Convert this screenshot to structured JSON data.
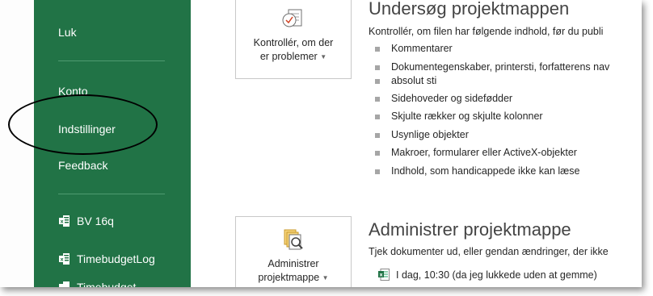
{
  "sidebar": {
    "items": [
      {
        "label": "Luk"
      },
      {
        "label": "Konto"
      },
      {
        "label": "Indstillinger"
      },
      {
        "label": "Feedback"
      }
    ],
    "recent_files": [
      {
        "label": "BV 16q",
        "icon": "excel-file-icon"
      },
      {
        "label": "TimebudgetLog",
        "icon": "excel-file-icon"
      },
      {
        "label": "Timebudget",
        "icon": "excel-file-icon"
      }
    ]
  },
  "inspect": {
    "button_label_line1": "Kontrollér, om der",
    "button_label_line2": "er problemer",
    "title": "Undersøg projektmappen",
    "description": "Kontrollér, om filen har følgende indhold, før du publi",
    "bullets": [
      "Kommentarer",
      "Dokumentegenskaber, printersti, forfatterens nav",
      "absolut sti",
      "Sidehoveder og sidefødder",
      "Skjulte rækker og skjulte kolonner",
      "Usynlige objekter",
      "Makroer, formularer eller ActiveX-objekter",
      "Indhold, som handicappede ikke kan læse"
    ]
  },
  "manage": {
    "button_label_line1": "Administrer",
    "button_label_line2": "projektmappe",
    "title": "Administrer projektmappe",
    "description": "Tjek dokumenter ud, eller gendan ændringer, der ikke",
    "version_text": "I dag, 10:30 (da jeg lukkede uden at gemme)"
  },
  "colors": {
    "sidebar_bg": "#217346",
    "annotation": "#000000"
  }
}
